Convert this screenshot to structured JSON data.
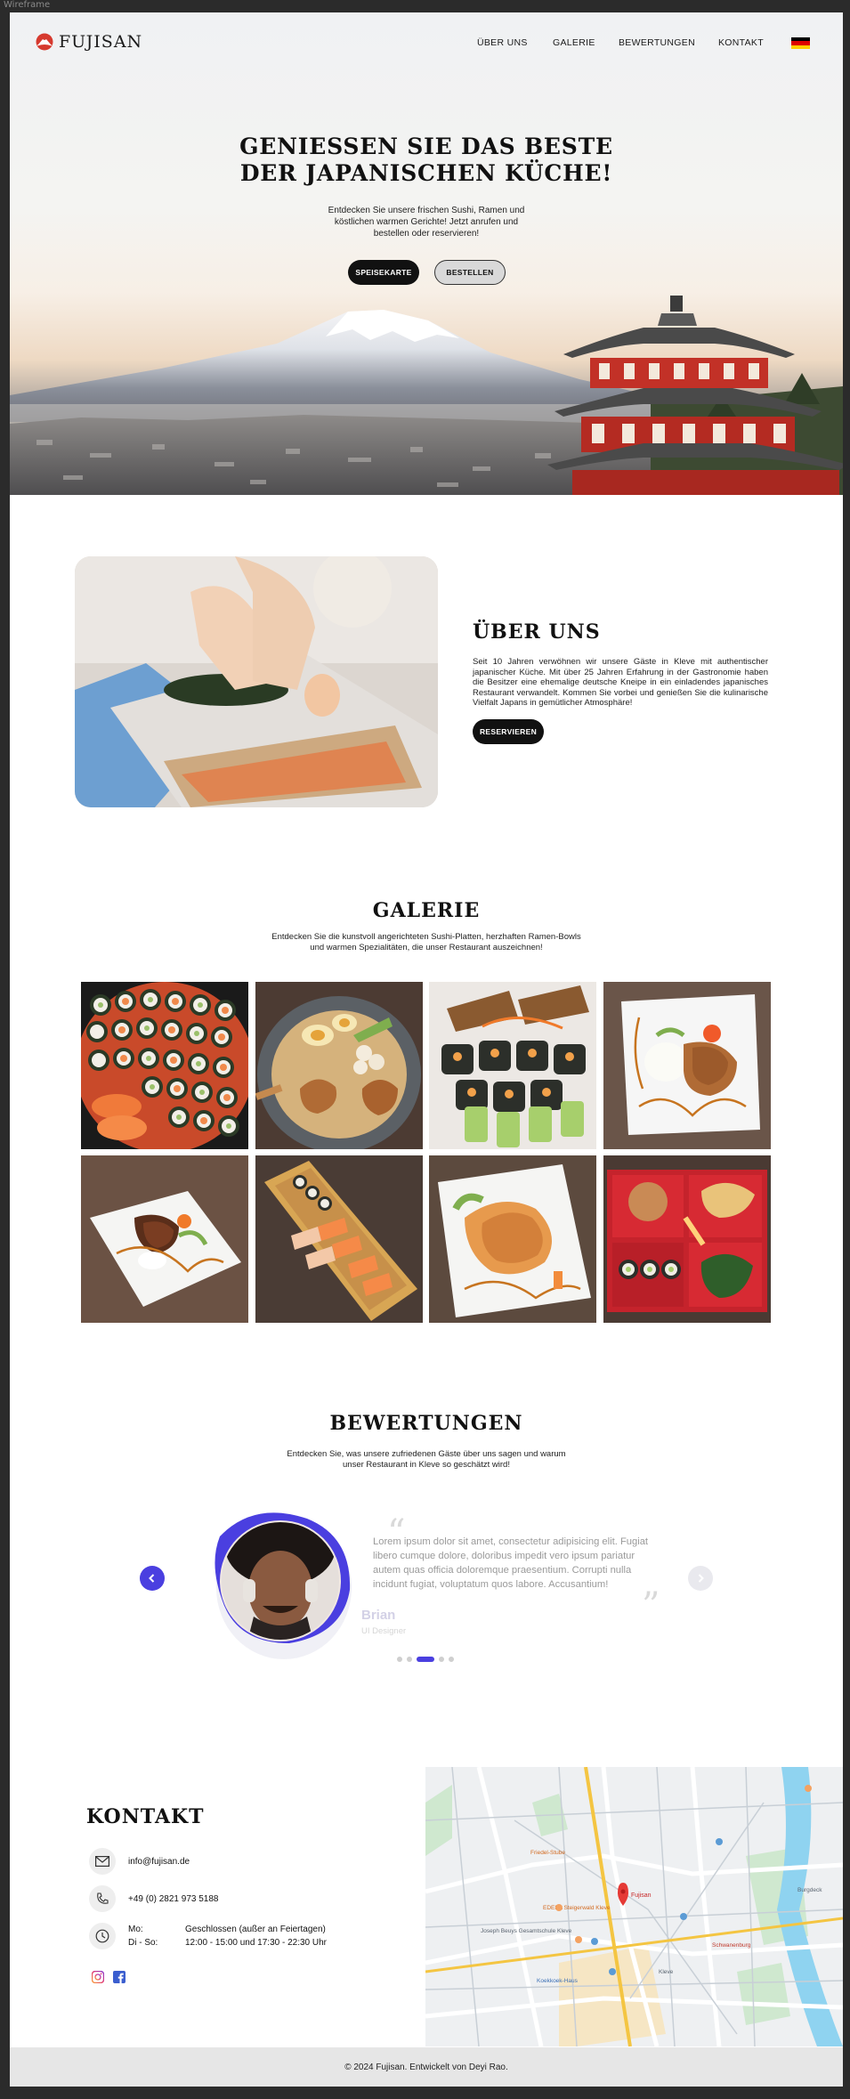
{
  "window": {
    "frame_label": "Wireframe"
  },
  "brand": {
    "name": "FUJISAN",
    "accent": "#d63a2f"
  },
  "nav": {
    "items": [
      "ÜBER UNS",
      "GALERIE",
      "BEWERTUNGEN",
      "KONTAKT"
    ],
    "language_flag": "german-flag-icon"
  },
  "hero": {
    "title_line1": "GENIESSEN SIE DAS BESTE",
    "title_line2": "DER JAPANISCHEN KÜCHE!",
    "subtitle": "Entdecken Sie unsere frischen Sushi, Ramen und köstlichen warmen Gerichte! Jetzt anrufen und bestellen oder reservieren!",
    "primary_button": "SPEISEKARTE",
    "secondary_button": "BESTELLEN"
  },
  "about": {
    "title": "ÜBER UNS",
    "text": "Seit 10 Jahren verwöhnen wir unsere Gäste in Kleve mit authentischer japanischer Küche. Mit über 25 Jahren Erfahrung in der Gastronomie haben die Besitzer eine ehemalige deutsche Kneipe in ein einladendes japanisches Restaurant verwandelt. Kommen Sie vorbei und genießen Sie die kulinarische Vielfalt Japans in gemütlicher Atmosphäre!",
    "button": "RESERVIEREN"
  },
  "gallery": {
    "title": "GALERIE",
    "subtitle": "Entdecken Sie die kunstvoll angerichteten Sushi-Platten, herzhaften Ramen-Bowls und warmen Spezialitäten, die unser Restaurant auszeichnen!",
    "items": [
      "sushi-platter",
      "ramen-bowl",
      "tempura-rolls",
      "chicken-rice-plate",
      "eel-plate",
      "sushi-boat",
      "shrimp-plate",
      "bento-box"
    ]
  },
  "reviews": {
    "title": "BEWERTUNGEN",
    "subtitle": "Entdecken Sie, was unsere zufriedenen Gäste über uns sagen und warum unser Restaurant in Kleve so geschätzt wird!",
    "quote": "Lorem ipsum dolor sit amet, consectetur adipisicing elit. Fugiat libero cumque dolore, doloribus impedit vero ipsum pariatur autem quas officia doloremque praesentium. Corrupti nulla incidunt fugiat, voluptatum quos labore. Accusantium!",
    "name": "Brian",
    "role": "UI Designer",
    "prev_icon": "chevron-left-icon",
    "next_icon": "chevron-right-icon",
    "slides": 5,
    "active_slide": 3,
    "accent": "#4a3fe0"
  },
  "contact": {
    "title": "KONTAKT",
    "email": "info@fujisan.de",
    "phone": "+49 (0) 2821 973 5188",
    "hours": [
      {
        "days": "Mo:",
        "time": "Geschlossen (außer an Feiertagen)"
      },
      {
        "days": "Di - So:",
        "time": "12:00 - 15:00 und 17:30 - 22:30 Uhr"
      }
    ],
    "socials": [
      "instagram-icon",
      "facebook-icon"
    ]
  },
  "map": {
    "labels": [
      "Fujisan",
      "Friedel-Stube",
      "Schwanenburg",
      "EDEKA Steigerwald Kleve",
      "Joseph Beuys Gesamtschule Kleve",
      "Koekkoek-Haus",
      "Kleve",
      "Burgdeck"
    ],
    "marker_label": "Fujisan"
  },
  "footer": {
    "text": "© 2024 Fujisan. Entwickelt von Deyi Rao."
  }
}
